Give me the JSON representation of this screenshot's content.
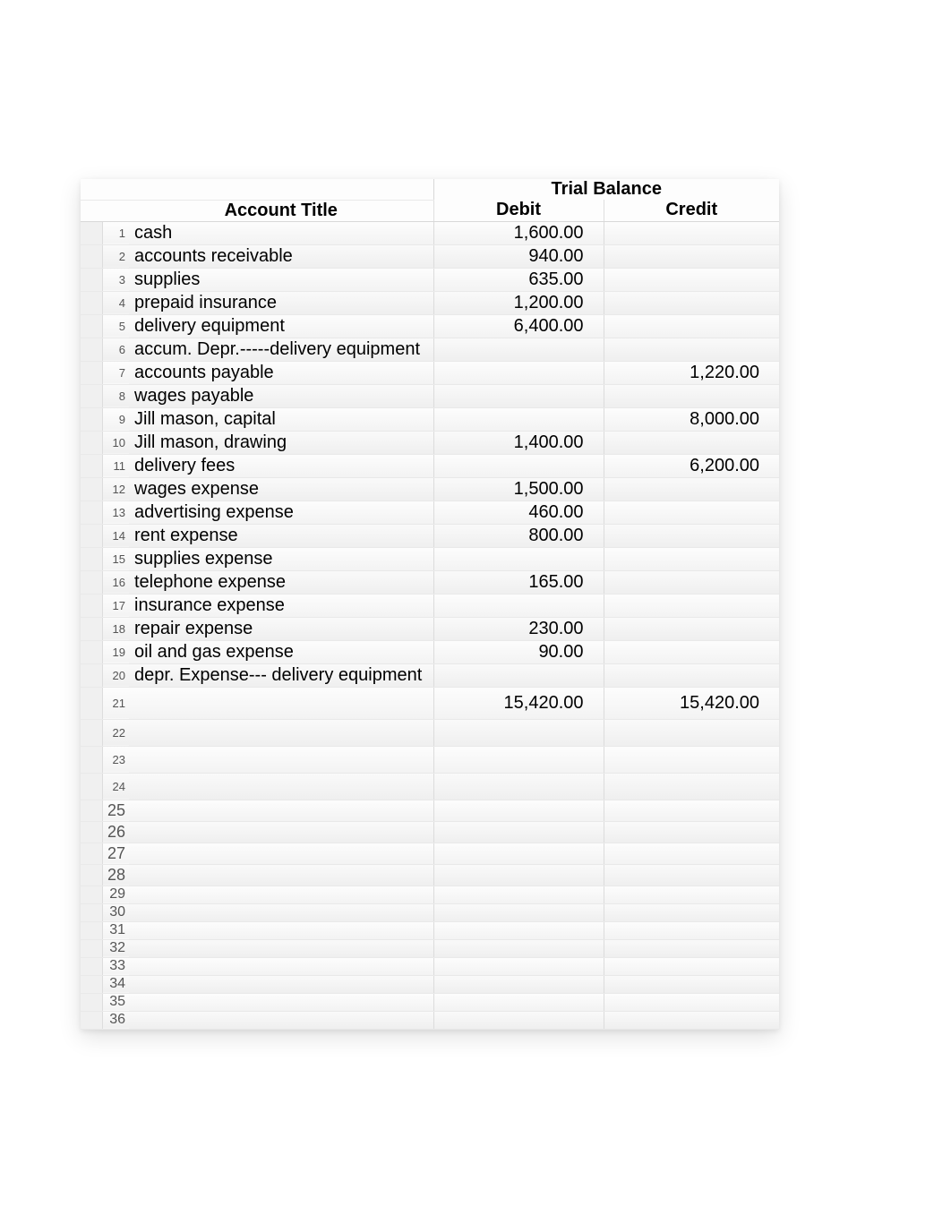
{
  "headers": {
    "trial_balance": "Trial Balance",
    "account_title": "Account Title",
    "debit": "Debit",
    "credit": "Credit"
  },
  "rows": [
    {
      "n": "1",
      "title": "cash",
      "debit": "1,600.00",
      "credit": ""
    },
    {
      "n": "2",
      "title": "accounts receivable",
      "debit": "940.00",
      "credit": ""
    },
    {
      "n": "3",
      "title": "supplies",
      "debit": "635.00",
      "credit": ""
    },
    {
      "n": "4",
      "title": "prepaid insurance",
      "debit": "1,200.00",
      "credit": ""
    },
    {
      "n": "5",
      "title": "delivery equipment",
      "debit": "6,400.00",
      "credit": ""
    },
    {
      "n": "6",
      "title": "accum. Depr.-----delivery equipment",
      "debit": "",
      "credit": ""
    },
    {
      "n": "7",
      "title": "accounts payable",
      "debit": "",
      "credit": "1,220.00"
    },
    {
      "n": "8",
      "title": "wages payable",
      "debit": "",
      "credit": ""
    },
    {
      "n": "9",
      "title": "Jill mason, capital",
      "debit": "",
      "credit": "8,000.00"
    },
    {
      "n": "10",
      "title": "Jill mason, drawing",
      "debit": "1,400.00",
      "credit": ""
    },
    {
      "n": "11",
      "title": "delivery fees",
      "debit": "",
      "credit": "6,200.00"
    },
    {
      "n": "12",
      "title": "wages expense",
      "debit": "1,500.00",
      "credit": ""
    },
    {
      "n": "13",
      "title": "advertising expense",
      "debit": "460.00",
      "credit": ""
    },
    {
      "n": "14",
      "title": "rent expense",
      "debit": "800.00",
      "credit": ""
    },
    {
      "n": "15",
      "title": "supplies expense",
      "debit": "",
      "credit": ""
    },
    {
      "n": "16",
      "title": "telephone expense",
      "debit": "165.00",
      "credit": ""
    },
    {
      "n": "17",
      "title": "insurance expense",
      "debit": "",
      "credit": ""
    },
    {
      "n": "18",
      "title": "repair expense",
      "debit": "230.00",
      "credit": ""
    },
    {
      "n": "19",
      "title": "oil and gas expense",
      "debit": "90.00",
      "credit": ""
    },
    {
      "n": "20",
      "title": "depr. Expense--- delivery equipment",
      "debit": "",
      "credit": ""
    }
  ],
  "totals": {
    "n": "21",
    "debit": "15,420.00",
    "credit": "15,420.00"
  },
  "blank_rows": [
    "22",
    "23",
    "24",
    "25",
    "26",
    "27",
    "28",
    "29",
    "30",
    "31",
    "32",
    "33",
    "34",
    "35",
    "36"
  ],
  "chart_data": {
    "type": "table",
    "title": "Trial Balance",
    "columns": [
      "Account Title",
      "Debit",
      "Credit"
    ],
    "data": [
      [
        "cash",
        1600.0,
        null
      ],
      [
        "accounts receivable",
        940.0,
        null
      ],
      [
        "supplies",
        635.0,
        null
      ],
      [
        "prepaid insurance",
        1200.0,
        null
      ],
      [
        "delivery equipment",
        6400.0,
        null
      ],
      [
        "accum. Depr.-----delivery equipment",
        null,
        null
      ],
      [
        "accounts payable",
        null,
        1220.0
      ],
      [
        "wages payable",
        null,
        null
      ],
      [
        "Jill mason, capital",
        null,
        8000.0
      ],
      [
        "Jill mason, drawing",
        1400.0,
        null
      ],
      [
        "delivery fees",
        null,
        6200.0
      ],
      [
        "wages expense",
        1500.0,
        null
      ],
      [
        "advertising expense",
        460.0,
        null
      ],
      [
        "rent expense",
        800.0,
        null
      ],
      [
        "supplies expense",
        null,
        null
      ],
      [
        "telephone expense",
        165.0,
        null
      ],
      [
        "insurance expense",
        null,
        null
      ],
      [
        "repair expense",
        230.0,
        null
      ],
      [
        "oil and gas expense",
        90.0,
        null
      ],
      [
        "depr. Expense--- delivery equipment",
        null,
        null
      ]
    ],
    "totals": {
      "debit": 15420.0,
      "credit": 15420.0
    }
  }
}
